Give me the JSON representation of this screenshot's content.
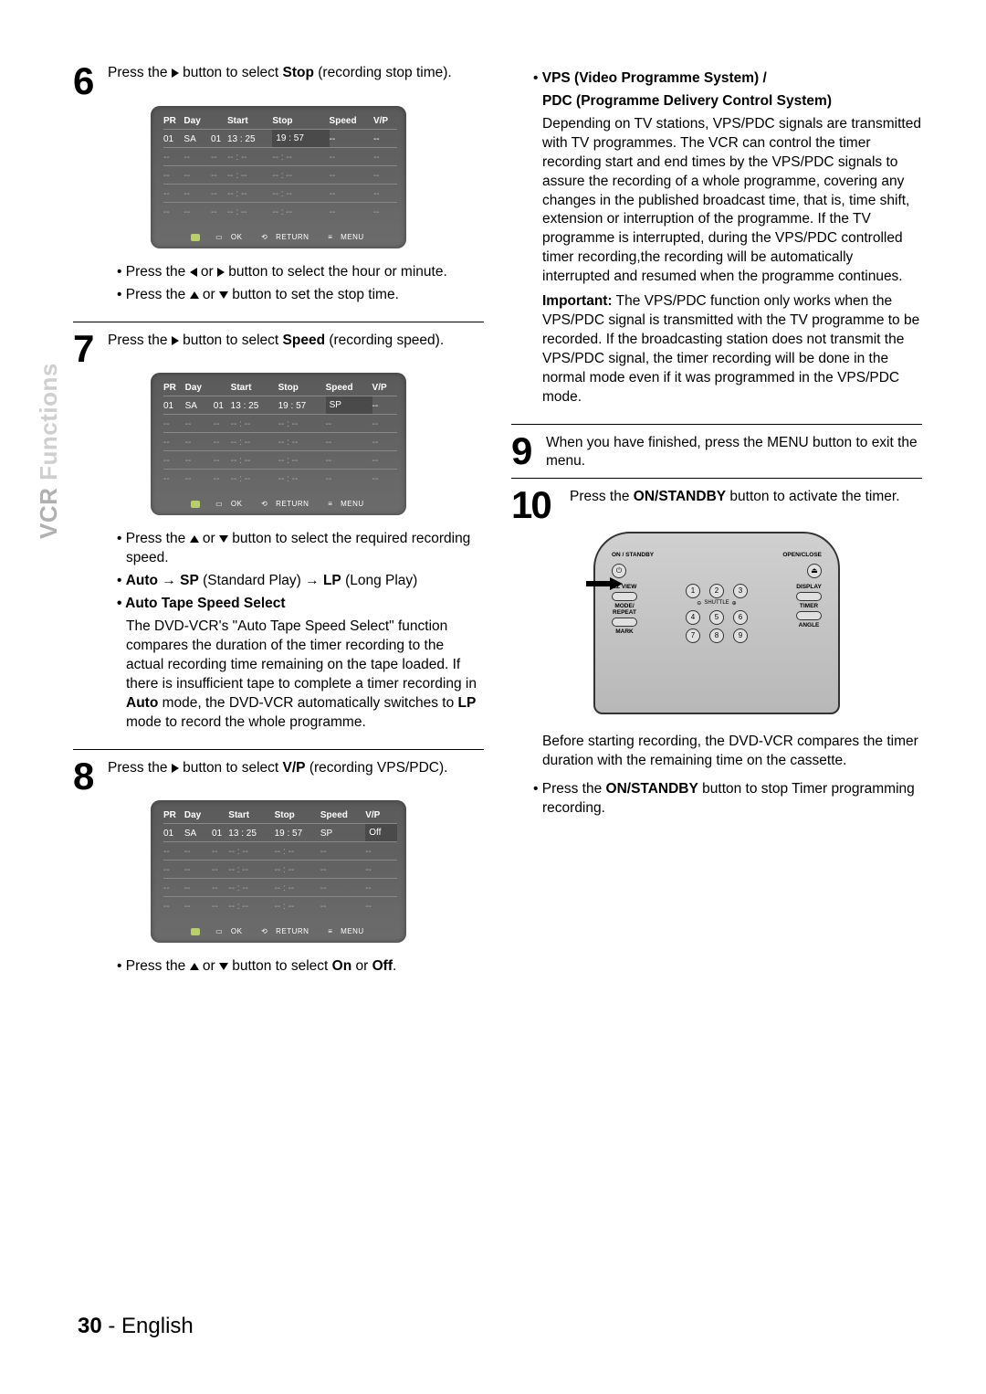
{
  "sideLabel": {
    "bold": "VCR",
    "light": " Functions"
  },
  "pageFooter": {
    "num": "30",
    "sep": " - ",
    "lang": "English"
  },
  "steps": {
    "6": {
      "num": "6",
      "textParts": [
        "Press the ",
        " button to select ",
        "Stop",
        " (recording stop time)."
      ],
      "bullets": [
        {
          "parts": [
            "• Press the ",
            " or ",
            " button to select the hour or minute."
          ],
          "icons": [
            "tri-l",
            "tri-r"
          ]
        },
        {
          "parts": [
            "• Press the ",
            " or ",
            " button to set the stop time."
          ],
          "icons": [
            "tri-u",
            "tri-d"
          ]
        }
      ]
    },
    "7": {
      "num": "7",
      "textParts": [
        "Press the ",
        " button to select ",
        "Speed",
        " (recording speed)."
      ],
      "bullets": [
        {
          "parts": [
            "• Press the ",
            " or ",
            " button to select the required recording speed."
          ],
          "icons": [
            "tri-u",
            "tri-d"
          ]
        },
        {
          "plain": "• Auto → SP (Standard Play) → LP (Long Play)",
          "boldWords": [
            "Auto",
            "SP",
            "LP"
          ]
        },
        {
          "heading": "• Auto Tape Speed Select"
        },
        {
          "body": "The DVD-VCR's \"Auto Tape Speed Select\" function compares the duration of the timer recording to the actual recording time remaining on the tape loaded. If there is insufficient tape to complete a timer recording in Auto mode, the DVD-VCR automatically switches to LP mode to record the whole programme."
        }
      ]
    },
    "8": {
      "num": "8",
      "textParts": [
        "Press the ",
        " button to select ",
        "V/P",
        " (recording VPS/PDC)."
      ],
      "bullets": [
        {
          "parts": [
            "• Press the ",
            " or ",
            " button to select ",
            "On",
            " or ",
            "Off",
            "."
          ],
          "icons": [
            "tri-u",
            "tri-d"
          ]
        }
      ]
    },
    "vps": {
      "heading1": "VPS (Video Programme System) /",
      "heading2": "PDC (Programme Delivery Control System)",
      "body1": "Depending on TV stations, VPS/PDC signals are transmitted with TV programmes. The VCR can control the timer recording start and end times by the VPS/PDC signals to assure the recording of a whole programme, covering any changes in the published broadcast time, that is, time shift, extension or interruption of the programme. If the TV programme is interrupted, during the VPS/PDC controlled timer recording,the recording will be automatically interrupted and resumed when the programme continues.",
      "importantLabel": "Important:",
      "body2": " The VPS/PDC function only works when the VPS/PDC signal is transmitted with the TV programme to be recorded. If the broadcasting station does not transmit the VPS/PDC signal, the timer recording will be done in the normal mode even if it was programmed in the VPS/PDC mode."
    },
    "9": {
      "num": "9",
      "text": "When you have finished, press the MENU button to exit the menu."
    },
    "10": {
      "num": "10",
      "textParts": [
        "Press the ",
        "ON/STANDBY",
        " button to activate the timer."
      ],
      "below": "Before starting recording, the DVD-VCR compares the timer duration with the remaining time on the cassette.",
      "bullet": {
        "parts": [
          "• Press the ",
          "ON/STANDBY",
          " button to stop Timer programming recording."
        ]
      }
    }
  },
  "osd": {
    "headers": [
      "PR",
      "Day",
      "",
      "Start",
      "Stop",
      "Speed",
      "V/P"
    ],
    "row1_base": [
      "01",
      "SA",
      "01",
      "13 : 25",
      "19 : 57",
      "--",
      "--"
    ],
    "row1_speed": [
      "01",
      "SA",
      "01",
      "13 : 25",
      "19 : 57",
      "SP",
      "--"
    ],
    "row1_vp": [
      "01",
      "SA",
      "01",
      "13 : 25",
      "19 : 57",
      "SP",
      "Off"
    ],
    "blank": [
      "--",
      "--",
      "--",
      "-- : --",
      "-- : --",
      "--",
      "--"
    ],
    "footer": {
      "ok": "OK",
      "return": "RETURN",
      "menu": "MENU"
    }
  },
  "remote": {
    "onstandby": "ON / STANDBY",
    "openclose": "OPEN/CLOSE",
    "ezview": "EZ VIEW",
    "display": "DISPLAY",
    "moderepeat": "MODE/\nREPEAT",
    "timer": "TIMER",
    "mark": "MARK",
    "angle": "ANGLE",
    "shuttle": "SHUTTLE",
    "eject": "⏏"
  }
}
